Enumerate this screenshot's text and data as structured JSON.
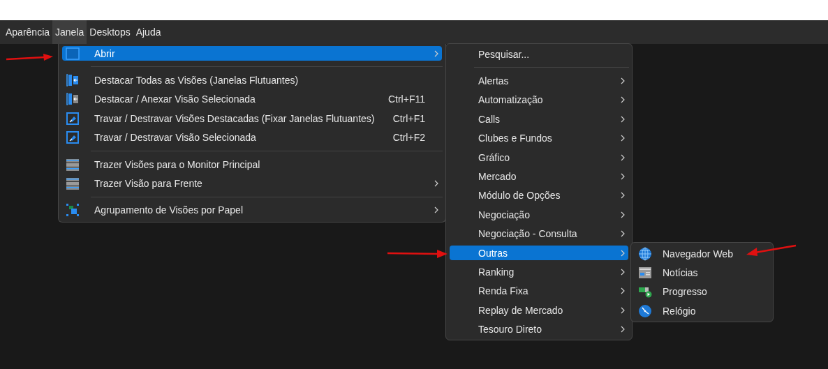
{
  "menu_bar": [
    {
      "label": "Aparência",
      "selected": false
    },
    {
      "label": "Janela",
      "selected": true
    },
    {
      "label": "Desktops",
      "selected": false
    },
    {
      "label": "Ajuda",
      "selected": false
    }
  ],
  "window_menu": {
    "items": [
      {
        "kind": "item",
        "label": "Abrir",
        "has_submenu": true,
        "selected": true
      },
      {
        "kind": "separator"
      },
      {
        "kind": "item",
        "label": "Destacar Todas as Visões (Janelas Flutuantes)",
        "has_submenu": false,
        "selected": false
      },
      {
        "kind": "item",
        "label": "Destacar / Anexar Visão Selecionada",
        "shortcut": "Ctrl+F11",
        "has_submenu": false,
        "selected": false
      },
      {
        "kind": "item",
        "label": "Travar / Destravar Visões Destacadas (Fixar Janelas Flutuantes)",
        "shortcut": "Ctrl+F1",
        "has_submenu": false,
        "selected": false
      },
      {
        "kind": "item",
        "label": "Travar / Destravar Visão Selecionada",
        "shortcut": "Ctrl+F2",
        "has_submenu": false,
        "selected": false
      },
      {
        "kind": "separator"
      },
      {
        "kind": "item",
        "label": "Trazer Visões para o Monitor Principal",
        "has_submenu": false,
        "selected": false
      },
      {
        "kind": "item",
        "label": "Trazer Visão para Frente",
        "has_submenu": true,
        "selected": false
      },
      {
        "kind": "separator"
      },
      {
        "kind": "item",
        "label": "Agrupamento de Visões por Papel",
        "has_submenu": true,
        "selected": false
      }
    ]
  },
  "open_submenu": {
    "items": [
      {
        "kind": "item",
        "label": "Pesquisar...",
        "has_submenu": false,
        "selected": false
      },
      {
        "kind": "separator"
      },
      {
        "kind": "item",
        "label": "Alertas",
        "has_submenu": true,
        "selected": false
      },
      {
        "kind": "item",
        "label": "Automatização",
        "has_submenu": true,
        "selected": false
      },
      {
        "kind": "item",
        "label": "Calls",
        "has_submenu": true,
        "selected": false
      },
      {
        "kind": "item",
        "label": "Clubes e Fundos",
        "has_submenu": true,
        "selected": false
      },
      {
        "kind": "item",
        "label": "Gráfico",
        "has_submenu": true,
        "selected": false
      },
      {
        "kind": "item",
        "label": "Mercado",
        "has_submenu": true,
        "selected": false
      },
      {
        "kind": "item",
        "label": "Módulo de Opções",
        "has_submenu": true,
        "selected": false
      },
      {
        "kind": "item",
        "label": "Negociação",
        "has_submenu": true,
        "selected": false
      },
      {
        "kind": "item",
        "label": "Negociação - Consulta",
        "has_submenu": true,
        "selected": false
      },
      {
        "kind": "item",
        "label": "Outras",
        "has_submenu": true,
        "selected": true
      },
      {
        "kind": "item",
        "label": "Ranking",
        "has_submenu": true,
        "selected": false
      },
      {
        "kind": "item",
        "label": "Renda Fixa",
        "has_submenu": true,
        "selected": false
      },
      {
        "kind": "item",
        "label": "Replay de Mercado",
        "has_submenu": true,
        "selected": false
      },
      {
        "kind": "item",
        "label": "Tesouro Direto",
        "has_submenu": true,
        "selected": false
      }
    ]
  },
  "others_submenu": {
    "items": [
      {
        "kind": "item",
        "label": "Navegador Web",
        "has_submenu": false,
        "selected": false
      },
      {
        "kind": "item",
        "label": "Notícias",
        "has_submenu": false,
        "selected": false
      },
      {
        "kind": "item",
        "label": "Progresso",
        "has_submenu": false,
        "selected": false
      },
      {
        "kind": "item",
        "label": "Relógio",
        "has_submenu": false,
        "selected": false
      }
    ]
  }
}
